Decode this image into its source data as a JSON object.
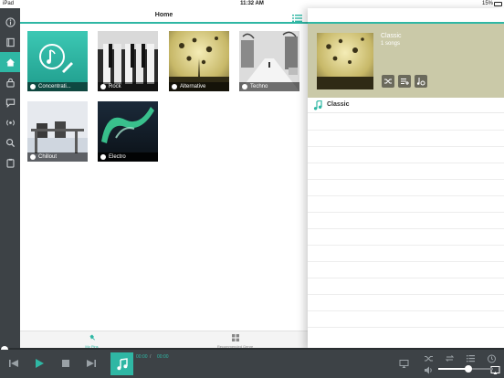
{
  "status_bar": {
    "carrier": "iPad",
    "time": "11:32 AM",
    "battery": "15%"
  },
  "rail": [
    {
      "icon": "info-icon"
    },
    {
      "icon": "book-icon"
    },
    {
      "icon": "home-icon",
      "active": true
    },
    {
      "icon": "lock-icon"
    },
    {
      "icon": "chat-icon"
    },
    {
      "icon": "radio-icon"
    },
    {
      "icon": "search-icon"
    },
    {
      "icon": "clipboard-icon"
    }
  ],
  "header": {
    "title": "Home"
  },
  "tiles": [
    {
      "label": "Concentrati...",
      "name": "tile-concentration"
    },
    {
      "label": "Rock",
      "name": "tile-rock"
    },
    {
      "label": "Alternative",
      "name": "tile-alternative"
    },
    {
      "label": "Techno",
      "name": "tile-techno"
    },
    {
      "label": "Chillout",
      "name": "tile-chillout"
    },
    {
      "label": "Electro",
      "name": "tile-electro"
    }
  ],
  "bottom_tabs": [
    {
      "label": "My Pins",
      "active": true
    },
    {
      "label": "Recommended Genre",
      "active": false
    }
  ],
  "detail": {
    "title": "Classic",
    "count": "1 songs",
    "rows": [
      {
        "title": "Classic"
      }
    ]
  },
  "player": {
    "time_current": "00:00",
    "separator": "/",
    "time_total": "00:00",
    "volume": 0.55
  },
  "colors": {
    "accent": "#2fb7a4",
    "rail": "#3d4246",
    "detail_header": "#cac9a8"
  }
}
